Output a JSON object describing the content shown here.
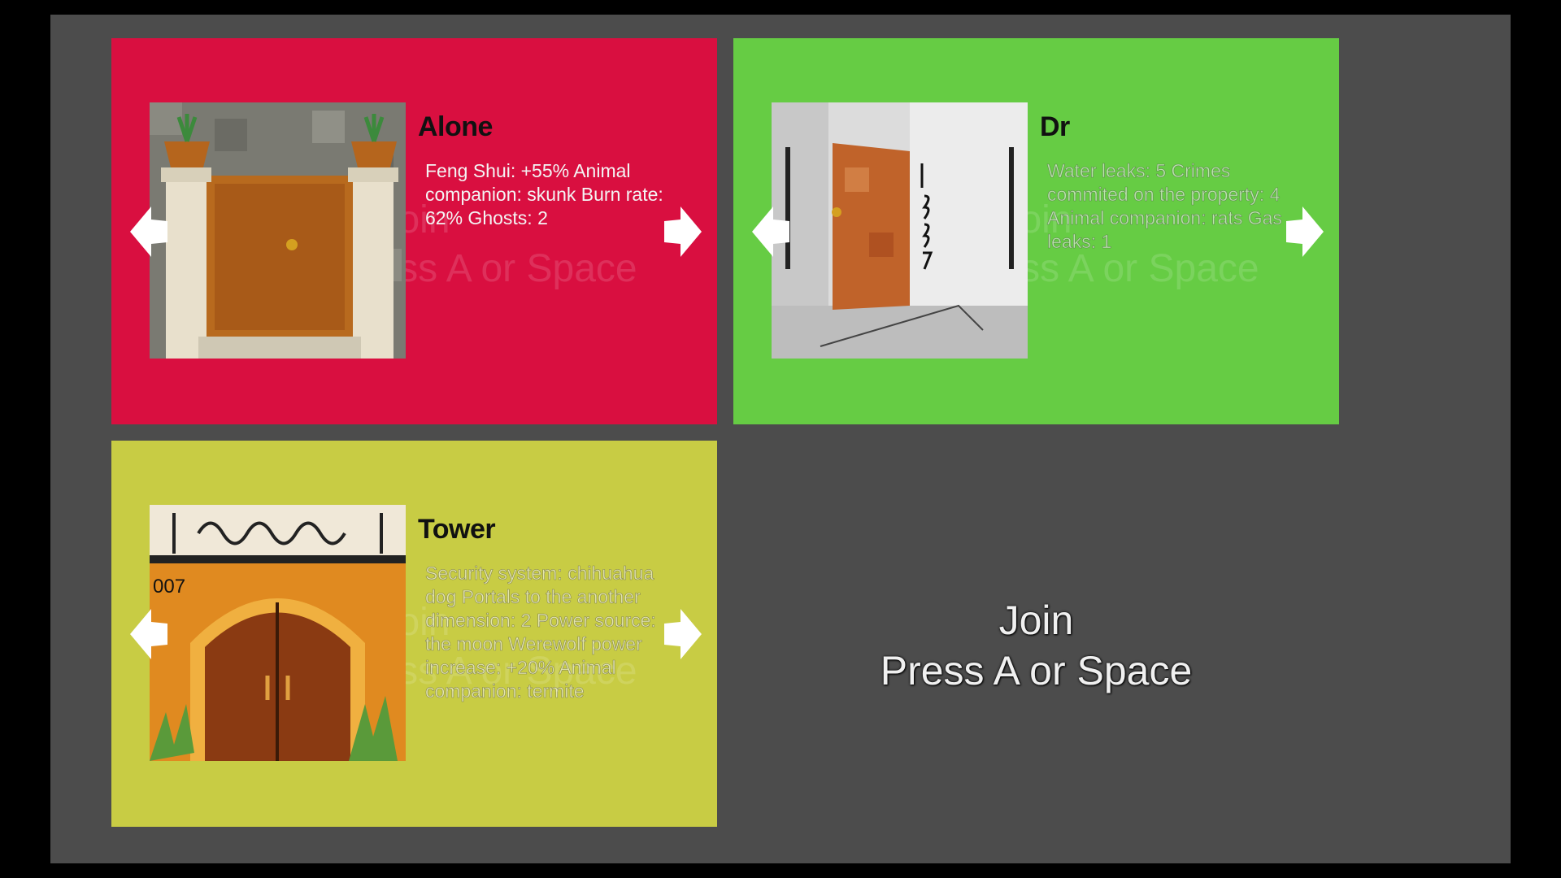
{
  "panels": [
    {
      "name": "Alone",
      "description": "Feng Shui: +55%  Animal companion: skunk Burn rate: 62% Ghosts: 2",
      "color": "#d90f40",
      "image": "door-with-pillars-and-plants"
    },
    {
      "name": "Dr",
      "description": "Water leaks: 5 Crimes commited on the property: 4 Animal companion: rats Gas leaks: 1",
      "color": "#66cc44",
      "image": "door-1337-hallway"
    },
    {
      "name": "Tower",
      "description": "Security system: chihuahua dog Portals to the another dimension: 2 Power source: the moon Werewolf power increase: +20% Animal companion: termite",
      "color": "#c8cc44",
      "image": "arched-door-007"
    }
  ],
  "join": {
    "line1": "Join",
    "line2": "Press A or Space"
  },
  "icons": {
    "prev": "arrow-left-icon",
    "next": "arrow-right-icon"
  }
}
